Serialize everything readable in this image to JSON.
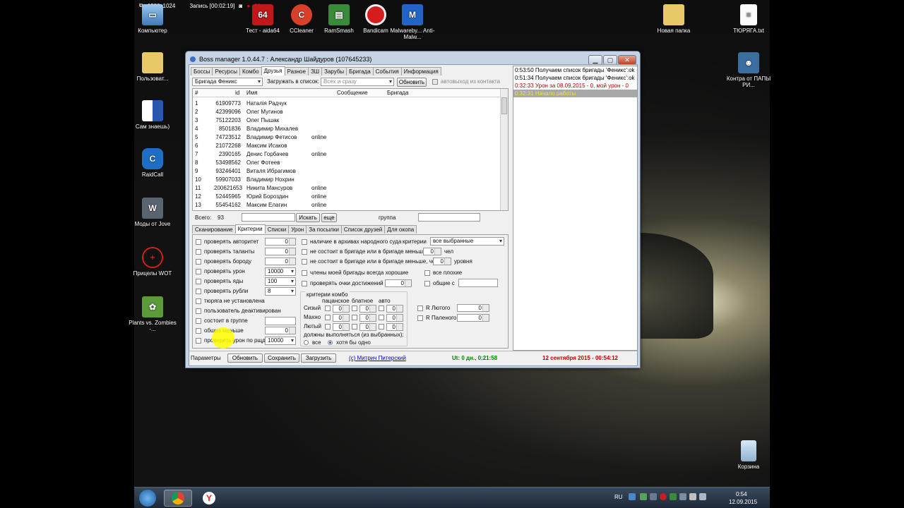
{
  "recorder": {
    "resolution": "1280x1024",
    "recording": "Запись [00:02:19]"
  },
  "desktop_icons": [
    {
      "label": "Компьютер"
    },
    {
      "label": "Тест - aida64"
    },
    {
      "label": "CCleaner"
    },
    {
      "label": "RamSmash"
    },
    {
      "label": "Bandicam"
    },
    {
      "label": "Malwareby... Anti-Malw..."
    },
    {
      "label": "Новая папка"
    },
    {
      "label": "ТЮРЯГА.txt"
    },
    {
      "label": "Пользоват..."
    },
    {
      "label": "Контра от ПАПЫ РИ..."
    },
    {
      "label": "Сам знаешь)"
    },
    {
      "label": "RaidCall"
    },
    {
      "label": "Моды от Jove"
    },
    {
      "label": "Прицелы WOT"
    },
    {
      "label": "Plants vs. Zombies -..."
    },
    {
      "label": "Корзина"
    }
  ],
  "window": {
    "title": "Boss manager 1.0.44.7 : Александр Шайдуров (107645233)"
  },
  "main_tabs": [
    "Боссы",
    "Ресурсы",
    "Комбо",
    "Друзья",
    "Разное",
    "ЗШ",
    "Зарубы",
    "Бригада",
    "События",
    "Информация"
  ],
  "filter": {
    "brigade": "Бригада Феникс",
    "load_label": "Загружать в список:",
    "load_value": "Всех и сразу",
    "refresh": "Обновить",
    "autoexit": "автовыход из контакта"
  },
  "table": {
    "headers": [
      "#",
      "id",
      "Имя",
      "Сообщение",
      "Бригада"
    ],
    "rows": [
      [
        "1",
        "61909773",
        "Наталія Радчук",
        ""
      ],
      [
        "2",
        "42399096",
        "Олег Мугинов",
        ""
      ],
      [
        "3",
        "75122203",
        "Олег Пышак",
        ""
      ],
      [
        "4",
        "8501836",
        "Владимир Михалев",
        ""
      ],
      [
        "5",
        "74723512",
        "Владимир Фетисов",
        "online"
      ],
      [
        "6",
        "21072268",
        "Максим Исаков",
        ""
      ],
      [
        "7",
        "2390165",
        "Денис Горбачев",
        "online"
      ],
      [
        "8",
        "53498562",
        "Олег Фотеев",
        ""
      ],
      [
        "9",
        "93246401",
        "Виталя Ибрагимов",
        ""
      ],
      [
        "10",
        "59907033",
        "Владимир Нохрин",
        ""
      ],
      [
        "11",
        "200621653",
        "Никита Мансуров",
        "online"
      ],
      [
        "12",
        "52445965",
        "Юрий Бороздин",
        "online"
      ],
      [
        "13",
        "55454162",
        "Максим Елагин",
        "online"
      ]
    ]
  },
  "search": {
    "total_label": "Всего:",
    "total": "93",
    "search_btn": "Искать",
    "more_btn": "еще",
    "group_label": "группа"
  },
  "sub_tabs": [
    "Сканирование",
    "Критерии",
    "Списки",
    "Урон",
    "За посылки",
    "Список друзей",
    "Для окопа"
  ],
  "criteria_left": [
    {
      "label": "проверять авторитет",
      "value": "0"
    },
    {
      "label": "проверять таланты",
      "value": "0"
    },
    {
      "label": "проверять бороду",
      "value": "0"
    },
    {
      "label": "проверять урон",
      "combo": "10000"
    },
    {
      "label": "проверять яды",
      "combo": "100"
    },
    {
      "label": "проверять рубли",
      "combo": "8"
    },
    {
      "label": "тюряга не установлена"
    },
    {
      "label": "пользователь деактивирован"
    },
    {
      "label": "состоит в группе"
    },
    {
      "label": "общих меньше",
      "value": "0"
    },
    {
      "label": "проверять урон по рщд",
      "combo": "10000"
    }
  ],
  "criteria_mid": {
    "archive": "наличие в архивах народного суда",
    "criteria_label": "критерии",
    "criteria_combo": "все выбранные",
    "not_in_brigade": "не состоит в бригаде или в бригаде меньше",
    "days_value": "0",
    "days_unit": "чел",
    "not_in_brigade2": "не состоит в бригаде или в бригаде меньше, чем",
    "level_value": "0",
    "level_unit": "уровня",
    "members_good": "члены моей бригады всегда хорошие",
    "all_bad": "все плохие",
    "check_points": "проверять очки достижений",
    "points_value": "0",
    "common_with": "общие с"
  },
  "combo_group": {
    "title": "критерии комбо",
    "cols": [
      "пацанское",
      "блатное",
      "авто"
    ],
    "rows": [
      {
        "label": "Сизый",
        "vals": [
          "0",
          "0",
          "0"
        ]
      },
      {
        "label": "Махно",
        "vals": [
          "0",
          "0",
          "0"
        ]
      },
      {
        "label": "Лютый",
        "vals": [
          "0",
          "0",
          "0"
        ]
      }
    ],
    "must_label": "должны выполняться (из выбранных):",
    "opt_all": "все",
    "opt_any": "хотя бы одно"
  },
  "r_group": [
    {
      "label": "R Лютого",
      "value": "0"
    },
    {
      "label": "R Паленого",
      "value": "0"
    }
  ],
  "status": {
    "params": "Параметры",
    "refresh": "Обновить",
    "save": "Сохранить",
    "load": "Загрузить",
    "author": "(c) Митрич Питерский",
    "uptime": "Ut: 0 дн., 0:21:58",
    "datetime": "12 сентября 2015 - 00:54:12"
  },
  "log": [
    {
      "text": "0:53:50 Получаем список бригады 'Феникс':ok",
      "color": "#000000"
    },
    {
      "text": "0:51:34 Получаем список бригады 'Феникс':ok",
      "color": "#000000"
    },
    {
      "text": "0:32:33 Урон за 08.09.2015 - 0, мой урон - 0",
      "color": "#b00000"
    },
    {
      "text": "0:32:31 Начало работы",
      "color": "#f0e040"
    }
  ],
  "taskbar": {
    "lang": "RU",
    "time": "0:54",
    "date": "12.09.2015"
  },
  "colors": {
    "uptime": "#008000",
    "datetime": "#c00000",
    "author": "#0000c0",
    "highlight": "#ffff00"
  }
}
